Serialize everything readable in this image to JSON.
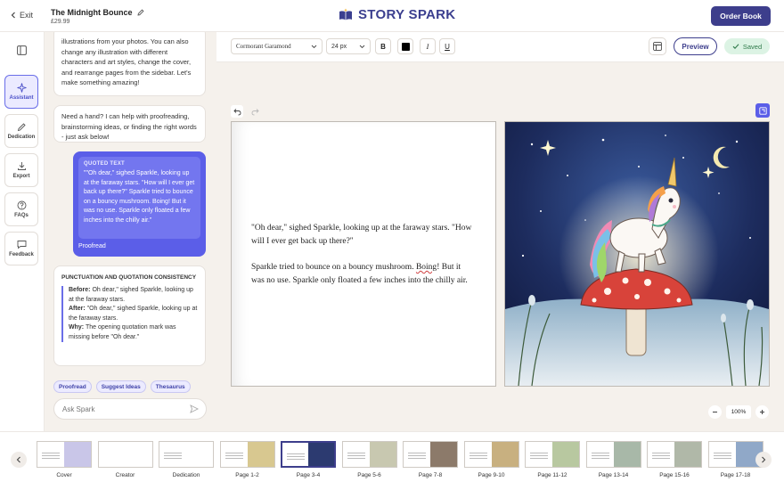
{
  "header": {
    "exit_label": "Exit",
    "book_title": "The Midnight Bounce",
    "price": "£29.99",
    "brand": "STORY SPARK",
    "order_button": "Order Book"
  },
  "sidebar": {
    "items": [
      {
        "label": "Assistant",
        "icon": "sparkle-icon",
        "active": true
      },
      {
        "label": "Dedication",
        "icon": "pen-icon",
        "active": false
      },
      {
        "label": "Export",
        "icon": "download-icon",
        "active": false
      },
      {
        "label": "FAQs",
        "icon": "help-icon",
        "active": false
      },
      {
        "label": "Feedback",
        "icon": "chat-icon",
        "active": false
      }
    ]
  },
  "chat": {
    "intro_message": "illustrations from your photos. You can also change any illustration with different characters and art styles, change the cover, and rearrange pages from the sidebar. Let's make something amazing!",
    "help_message": "Need a hand? I can help with proofreading, brainstorming ideas, or finding the right words - just ask below!",
    "quoted": {
      "header": "QUOTED TEXT",
      "text": "\"\"Oh dear,\" sighed Sparkle, looking up at the faraway stars. \"How will I ever get back up there?\" Sparkle tried to bounce on a bouncy mushroom. Boing! But it was no use. Sparkle only floated a few inches into the chilly air.\"",
      "action": "Proofread"
    },
    "result": {
      "title": "PUNCTUATION AND QUOTATION CONSISTENCY",
      "before_label": "Before:",
      "before_text": "Oh dear,\" sighed Sparkle, looking up at the faraway stars.",
      "after_label": "After:",
      "after_text": "\"Oh dear,\" sighed Sparkle, looking up at the faraway stars.",
      "why_label": "Why:",
      "why_text": "The opening quotation mark was missing before \"Oh dear.\""
    },
    "chips": [
      "Proofread",
      "Suggest Ideas",
      "Thesaurus"
    ],
    "input_placeholder": "Ask Spark"
  },
  "toolbar": {
    "font": "Cormorant Garamond",
    "size": "24 px",
    "bold": "B",
    "italic": "I",
    "underline": "U",
    "text_color": "#000000",
    "preview": "Preview",
    "saved": "Saved"
  },
  "page": {
    "paragraph1": "\"Oh dear,\" sighed Sparkle, looking up at the faraway stars. \"How will I ever get back up there?\"",
    "p2_before": "Sparkle tried to bounce on a bouncy mushroom. ",
    "p2_flagged": "Boing",
    "p2_after": "! But it was no use. Sparkle only floated a few inches into the chilly air.",
    "zoom": "100%"
  },
  "pages": [
    {
      "label": "Cover",
      "active": false
    },
    {
      "label": "Creator",
      "active": false
    },
    {
      "label": "Dedication",
      "active": false
    },
    {
      "label": "Page 1-2",
      "active": false
    },
    {
      "label": "Page 3-4",
      "active": true
    },
    {
      "label": "Page 5-6",
      "active": false
    },
    {
      "label": "Page 7-8",
      "active": false
    },
    {
      "label": "Page 9-10",
      "active": false
    },
    {
      "label": "Page 11-12",
      "active": false
    },
    {
      "label": "Page 13-14",
      "active": false
    },
    {
      "label": "Page 15-16",
      "active": false
    },
    {
      "label": "Page 17-18",
      "active": false
    }
  ],
  "colors": {
    "brand": "#3d3e8c",
    "accent": "#5b5ee8",
    "saved_bg": "#dcf3e4"
  }
}
